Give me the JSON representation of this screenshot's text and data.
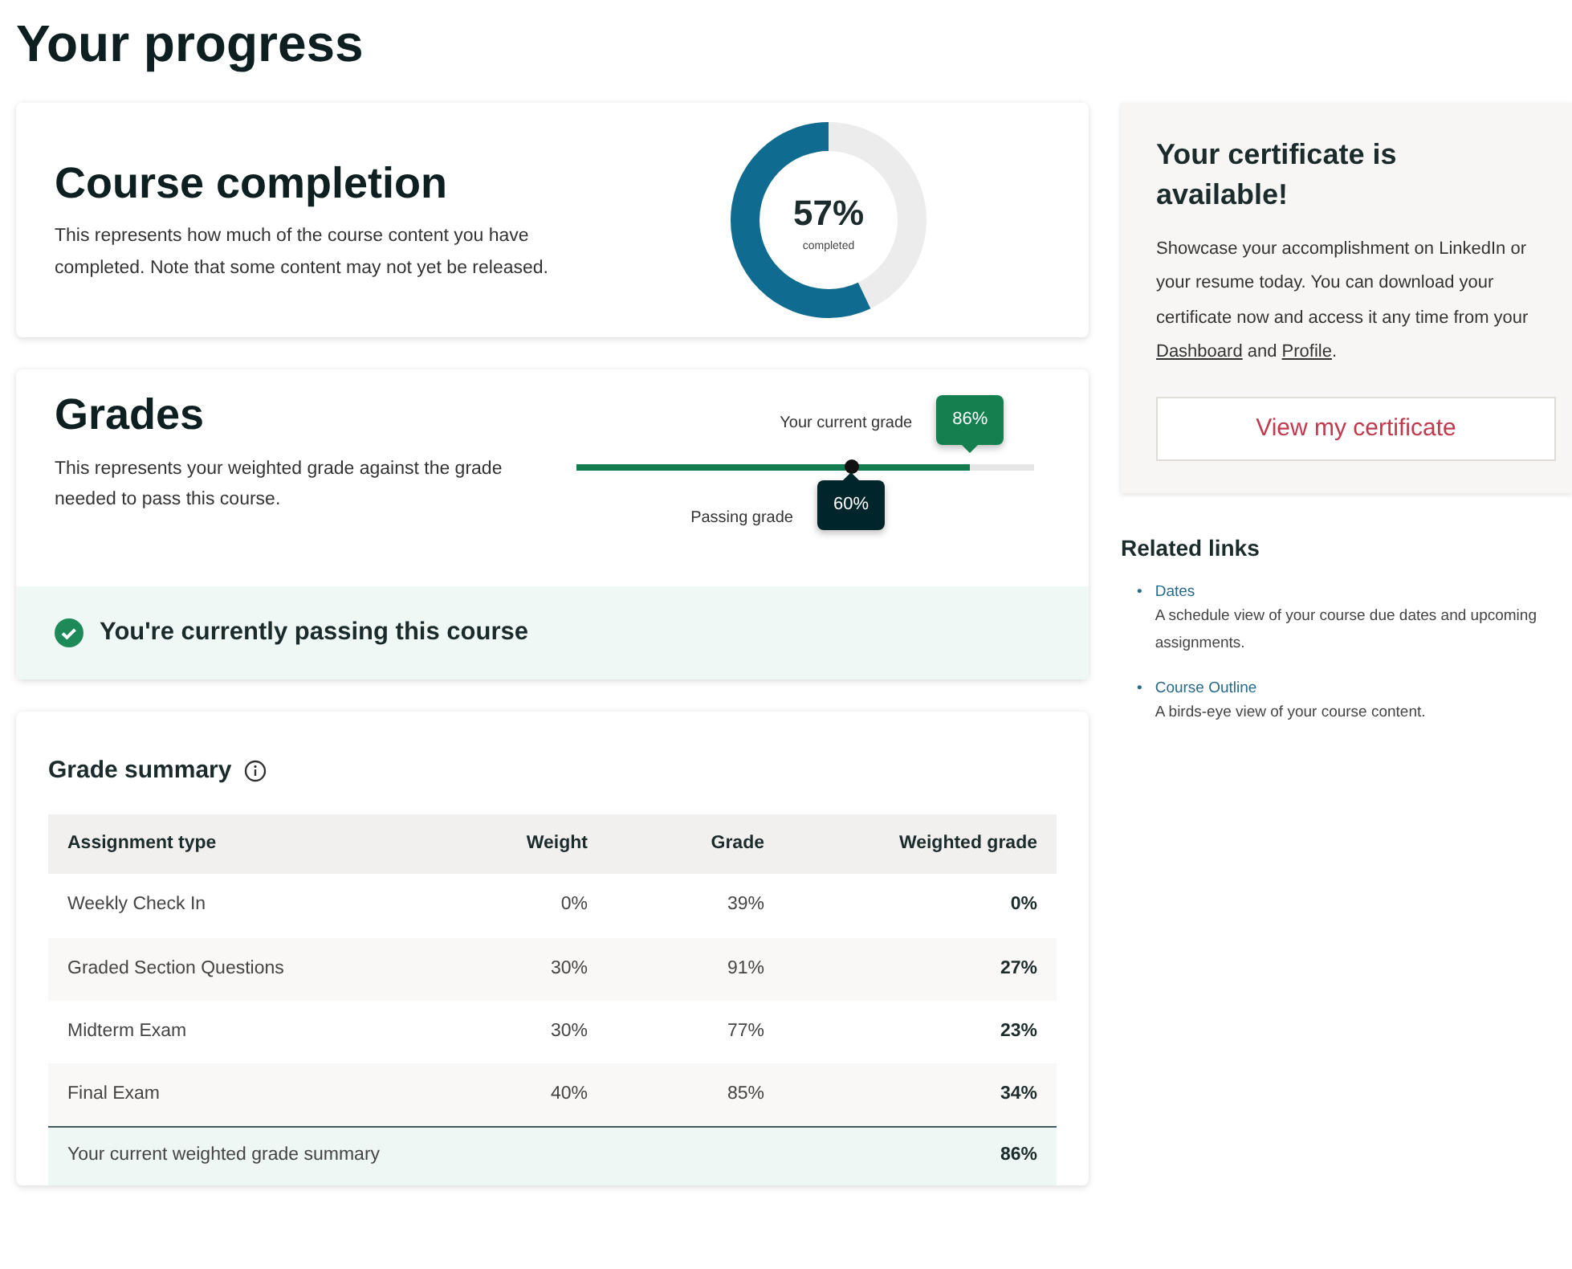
{
  "page": {
    "title": "Your progress"
  },
  "completion": {
    "title": "Course completion",
    "description": "This represents how much of the course content you have completed. Note that some content may not yet be released.",
    "level": 0.57,
    "percent": "57%",
    "caption": "completed"
  },
  "grades": {
    "title": "Grades",
    "description": "This represents your weighted grade against the grade needed to pass this course.",
    "current": {
      "label": "Your current grade",
      "value": "86%",
      "level": 0.86
    },
    "passing": {
      "label": "Passing grade",
      "value": "60%",
      "level": 0.6
    },
    "status": {
      "passing": true,
      "message": "You're currently passing this course"
    }
  },
  "summary": {
    "title": "Grade summary",
    "columns": [
      "Assignment type",
      "Weight",
      "Grade",
      "Weighted grade"
    ],
    "rows": [
      [
        "Weekly Check In",
        "0%",
        "39%",
        "0%"
      ],
      [
        "Graded Section Questions",
        "30%",
        "91%",
        "27%"
      ],
      [
        "Midterm Exam",
        "30%",
        "77%",
        "23%"
      ],
      [
        "Final Exam",
        "40%",
        "85%",
        "34%"
      ]
    ],
    "total": {
      "label": "Your current weighted grade summary",
      "value": "86%"
    }
  },
  "certificate": {
    "title": "Your certificate is available!",
    "parts": [
      {
        "kind": "text",
        "text": "Showcase your accomplishment on LinkedIn or your resume today. You can download your certificate now and access it any time from your "
      },
      {
        "kind": "link",
        "text": "Dashboard"
      },
      {
        "kind": "text",
        "text": " and "
      },
      {
        "kind": "link",
        "text": "Profile"
      },
      {
        "kind": "text",
        "text": "."
      }
    ],
    "button": "View my certificate"
  },
  "related": {
    "title": "Related links",
    "items": [
      {
        "marker": "•",
        "link": "Dates",
        "description": "A schedule view of your course due dates and upcoming assignments."
      },
      {
        "marker": "•",
        "link": "Course Outline",
        "description": "A birds-eye view of your course content."
      }
    ]
  }
}
